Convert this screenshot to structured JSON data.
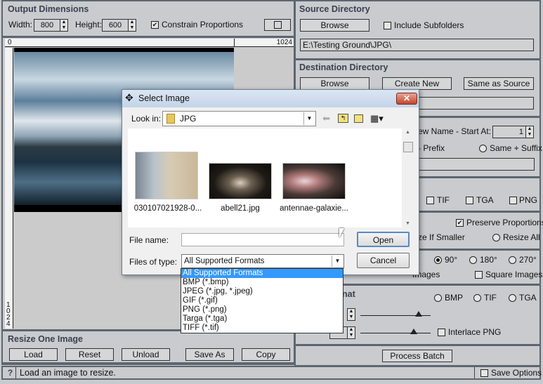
{
  "output_dimensions": {
    "title": "Output Dimensions",
    "width_label": "Width:",
    "width_value": "800",
    "height_label": "Height:",
    "height_value": "600",
    "constrain_label": "Constrain Proportions",
    "constrain_checked": true
  },
  "ruler": {
    "h_start": "0",
    "h_end": "1024",
    "v_end": "1024"
  },
  "resize_one": {
    "title": "Resize One Image",
    "buttons": [
      "Load",
      "Reset",
      "Unload",
      "Save As",
      "Copy"
    ]
  },
  "status": {
    "help": "?",
    "message": "Load an image to resize.",
    "save_options": "Save Options",
    "save_options_checked": false
  },
  "source": {
    "title": "Source Directory",
    "browse": "Browse",
    "include_subfolders": "Include Subfolders",
    "include_checked": false,
    "path": "E:\\Testing Ground\\JPG\\"
  },
  "destination": {
    "title": "Destination Directory",
    "browse": "Browse",
    "create_new": "Create New",
    "same_as_source": "Same as Source",
    "path": ""
  },
  "rename": {
    "new_name_label": "ew Name  -  Start At:",
    "start_at": "1",
    "prefix_label": "- Prefix",
    "same_suffix": "Same + Suffix"
  },
  "formats": {
    "tif": "TIF",
    "tga": "TGA",
    "png": "PNG"
  },
  "resize": {
    "preserve": "Preserve Proportions",
    "preserve_checked": true,
    "if_smaller": "ze If Smaller",
    "resize_all": "Resize All"
  },
  "rotate": {
    "r90": "90°",
    "r180": "180°",
    "r270": "270°",
    "selected": "90°",
    "tiles": "Images",
    "square": "Square Images"
  },
  "output_format": {
    "title_fragment": "nat",
    "bmp": "BMP",
    "tif": "TIF",
    "tga": "TGA",
    "interlace": "Interlace PNG",
    "quality_slider": 0.85,
    "compression_slider": 0.78
  },
  "process": {
    "label": "Process Batch"
  },
  "dialog": {
    "title": "Select Image",
    "look_in_label": "Look in:",
    "look_in_value": "JPG",
    "files": [
      {
        "name": "030107021928-0..."
      },
      {
        "name": "abell21.jpg"
      },
      {
        "name": "antennae-galaxie..."
      }
    ],
    "file_name_label": "File name:",
    "file_name_value": "",
    "files_of_type_label": "Files of type:",
    "files_of_type_value": "All Supported Formats",
    "open": "Open",
    "cancel": "Cancel",
    "type_options": [
      "All Supported Formats",
      "BMP (*.bmp)",
      "JPEG (*.jpg, *.jpeg)",
      "GIF (*.gif)",
      "PNG (*.png)",
      "Targa (*.tga)",
      "TIFF (*.tif)"
    ]
  },
  "colors": {
    "panel": "#c9cbce",
    "border": "#5d6670",
    "highlight": "#3399ff"
  }
}
